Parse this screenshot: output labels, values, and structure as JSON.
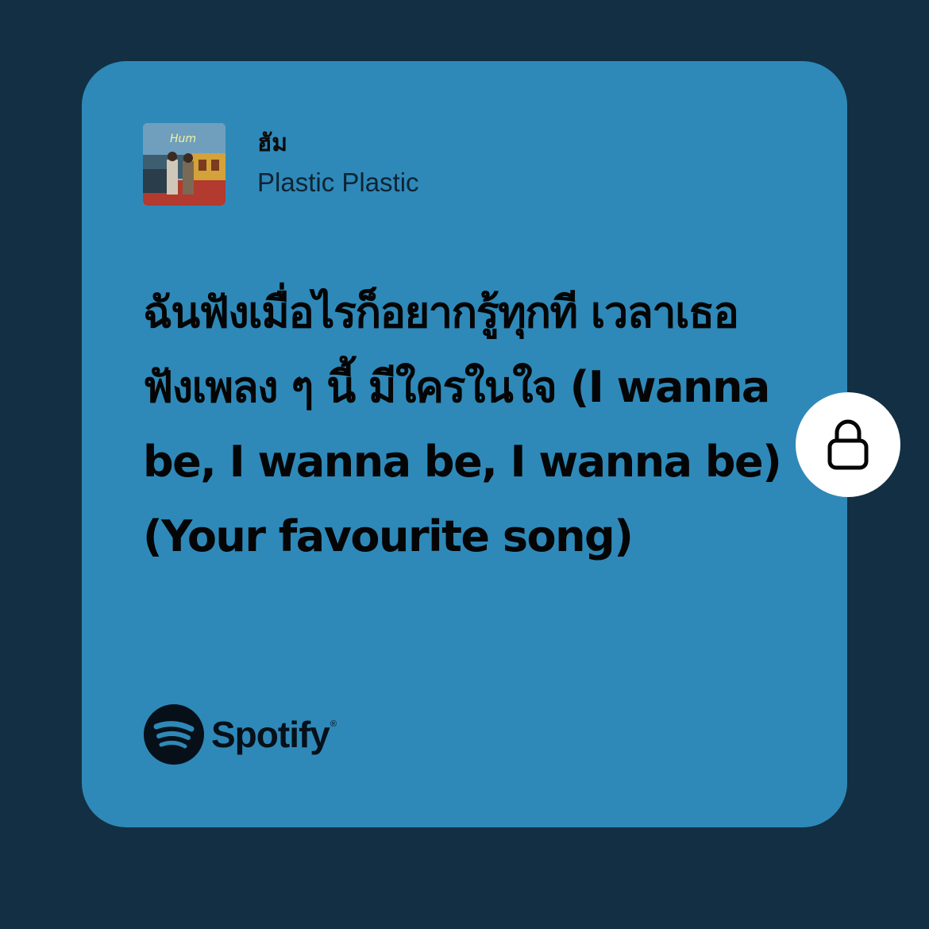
{
  "track": {
    "title": "ฮัม",
    "artist": "Plastic Plastic",
    "cover_icon": "album-cover-image",
    "cover_text": "Hum"
  },
  "lyrics": "ฉันฟังเมื่อไรก็อยากรู้ทุกที เวลาเธอฟังเพลง ๆ นี้ มีใครในใจ (I wanna be, I wanna be, I wanna be) (Your favourite song)",
  "brand": {
    "name": "Spotify",
    "trademark": "®",
    "icon": "spotify-logo-icon"
  },
  "lock": {
    "icon": "lock-icon"
  },
  "colors": {
    "background": "#132f43",
    "card": "#2e89b9",
    "text": "#050505",
    "lock_button": "#ffffff"
  }
}
